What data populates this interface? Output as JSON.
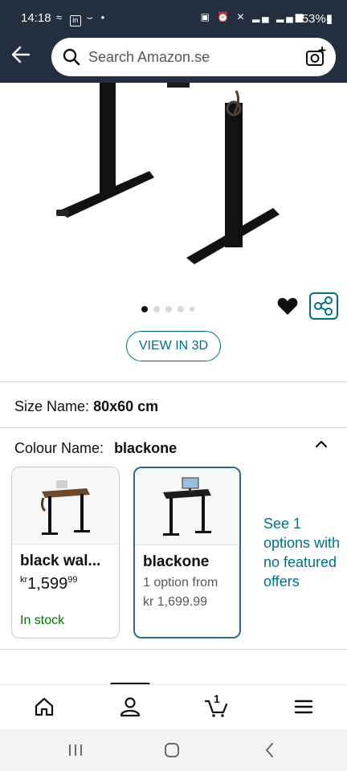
{
  "status_bar": {
    "time": "14:18",
    "battery": "53%",
    "left_icons": [
      "wifi-calling-icon",
      "linkedin-icon",
      "voicemail-icon",
      "dot-icon"
    ],
    "right_icons": [
      "nfc-icon",
      "alarm-icon",
      "mute-icon",
      "signal-icon",
      "4g-signal-icon",
      "battery-icon"
    ]
  },
  "search": {
    "placeholder": "Search Amazon.se",
    "back_icon": "back-arrow-icon",
    "camera_icon": "camera-search-icon"
  },
  "gallery": {
    "image_count": 5,
    "active_index": 0,
    "view_3d_label": "VIEW IN 3D"
  },
  "size": {
    "label": "Size Name:",
    "value": "80x60 cm"
  },
  "colour": {
    "label": "Colour Name:",
    "value": "blackone",
    "options": [
      {
        "name": "black wal...",
        "price_currency": "kr",
        "price_whole": "1,599",
        "price_fraction": "99",
        "availability": "In stock",
        "selected": false
      },
      {
        "name": "blackone",
        "option_line": "1 option from",
        "option_price": "kr 1,699.99",
        "selected": true
      }
    ],
    "see_more_lines": [
      "See 1",
      "options with",
      "no featured",
      "offers"
    ]
  },
  "bottom_nav": {
    "items": [
      "home-icon",
      "account-icon",
      "cart-icon",
      "menu-icon"
    ],
    "cart_count": "1"
  },
  "colors": {
    "header_bg": "#232f3e",
    "link": "#007185",
    "in_stock": "#007600",
    "selected_border": "#2d6a8c"
  }
}
